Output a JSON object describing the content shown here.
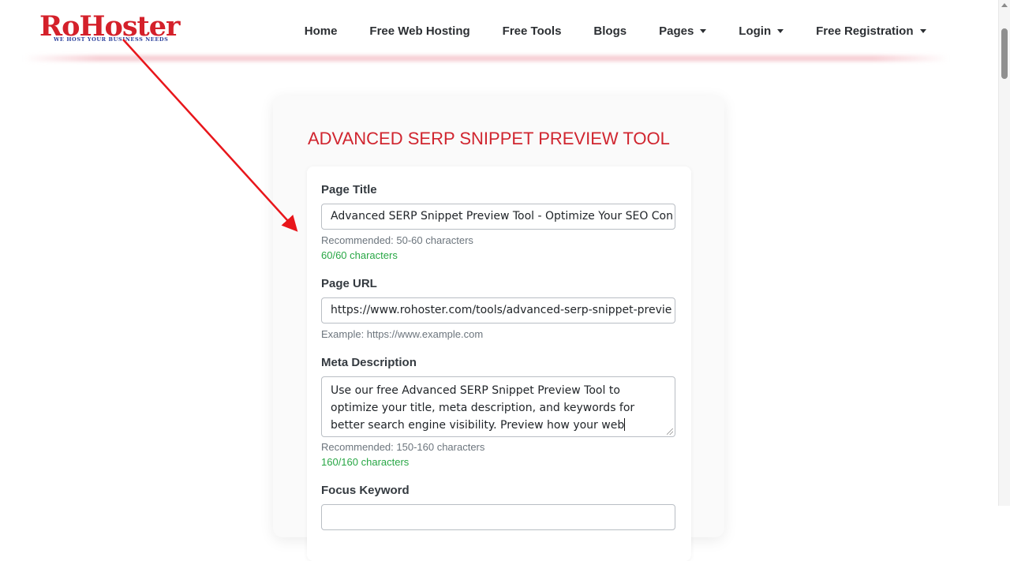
{
  "header": {
    "logo_text": "RoHoster",
    "logo_tagline": "WE HOST YOUR BUSINESS NEEDS",
    "nav": [
      {
        "label": "Home",
        "dropdown": false
      },
      {
        "label": "Free Web Hosting",
        "dropdown": false
      },
      {
        "label": "Free Tools",
        "dropdown": false
      },
      {
        "label": "Blogs",
        "dropdown": false
      },
      {
        "label": "Pages",
        "dropdown": true
      },
      {
        "label": "Login",
        "dropdown": true
      },
      {
        "label": "Free Registration",
        "dropdown": true
      }
    ]
  },
  "tool": {
    "title": "ADVANCED SERP SNIPPET PREVIEW TOOL",
    "page_title": {
      "label": "Page Title",
      "value": "Advanced SERP Snippet Preview Tool - Optimize Your SEO Con",
      "help": "Recommended: 50-60 characters",
      "count": "60/60 characters"
    },
    "page_url": {
      "label": "Page URL",
      "value": "https://www.rohoster.com/tools/advanced-serp-snippet-previe",
      "help": "Example: https://www.example.com"
    },
    "meta_description": {
      "label": "Meta Description",
      "value": "Use our free Advanced SERP Snippet Preview Tool to optimize your title, meta description, and keywords for better search engine visibility. Preview how your web",
      "help": "Recommended: 150-160 characters",
      "count": "160/160 characters"
    },
    "focus_keyword": {
      "label": "Focus Keyword"
    }
  },
  "colors": {
    "brand_red": "#d4202a",
    "title_red": "#d0252f",
    "success_green": "#28a745",
    "annotation_arrow": "#e8161b"
  }
}
